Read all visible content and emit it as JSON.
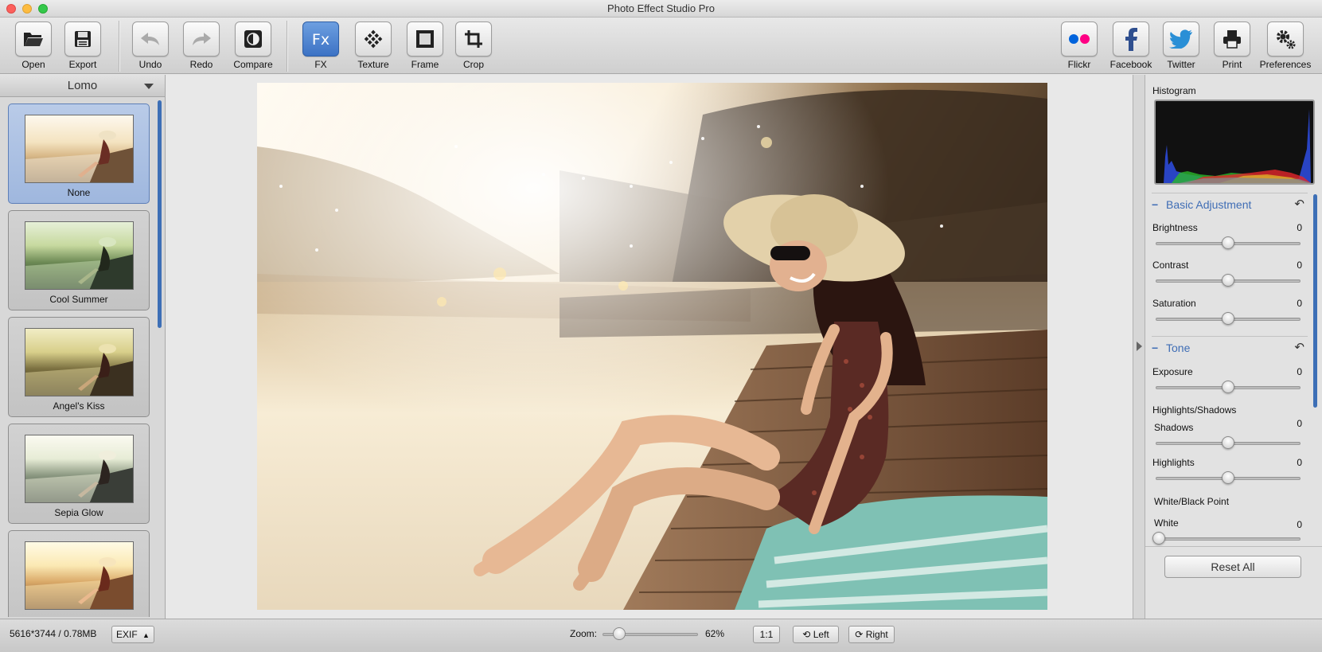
{
  "window": {
    "title": "Photo Effect Studio Pro"
  },
  "toolbar": {
    "open": "Open",
    "export": "Export",
    "undo": "Undo",
    "redo": "Redo",
    "compare": "Compare",
    "fx": "FX",
    "fx_glyph": "Fx",
    "texture": "Texture",
    "frame": "Frame",
    "crop": "Crop",
    "flickr": "Flickr",
    "facebook": "Facebook",
    "twitter": "Twitter",
    "print": "Print",
    "preferences": "Preferences"
  },
  "effects_panel": {
    "category": "Lomo",
    "items": [
      {
        "label": "None",
        "selected": true
      },
      {
        "label": "Cool Summer",
        "selected": false
      },
      {
        "label": "Angel's Kiss",
        "selected": false
      },
      {
        "label": "Sepia Glow",
        "selected": false
      },
      {
        "label": "",
        "selected": false
      }
    ]
  },
  "adjustments": {
    "histogram_title": "Histogram",
    "basic": {
      "title": "Basic Adjustment",
      "brightness": {
        "label": "Brightness",
        "value": "0"
      },
      "contrast": {
        "label": "Contrast",
        "value": "0"
      },
      "saturation": {
        "label": "Saturation",
        "value": "0"
      }
    },
    "tone": {
      "title": "Tone",
      "exposure": {
        "label": "Exposure",
        "value": "0"
      },
      "highlights_shadows": "Highlights/Shadows",
      "shadows": {
        "label": "Shadows",
        "value": "0"
      },
      "highlights": {
        "label": "Highlights",
        "value": "0"
      },
      "white_black_point": "White/Black Point",
      "white": {
        "label": "White",
        "value": "0"
      }
    },
    "reset_all": "Reset All"
  },
  "statusbar": {
    "file_info": "5616*3744 / 0.78MB",
    "exif": "EXIF",
    "zoom_label": "Zoom:",
    "zoom_value": "62%",
    "one_to_one": "1:1",
    "rotate_left": "Left",
    "rotate_right": "Right"
  },
  "colors": {
    "accent": "#3f6db5",
    "fx_active": "#4a80d0",
    "flickr_blue": "#0063dc",
    "flickr_pink": "#ff0084"
  }
}
